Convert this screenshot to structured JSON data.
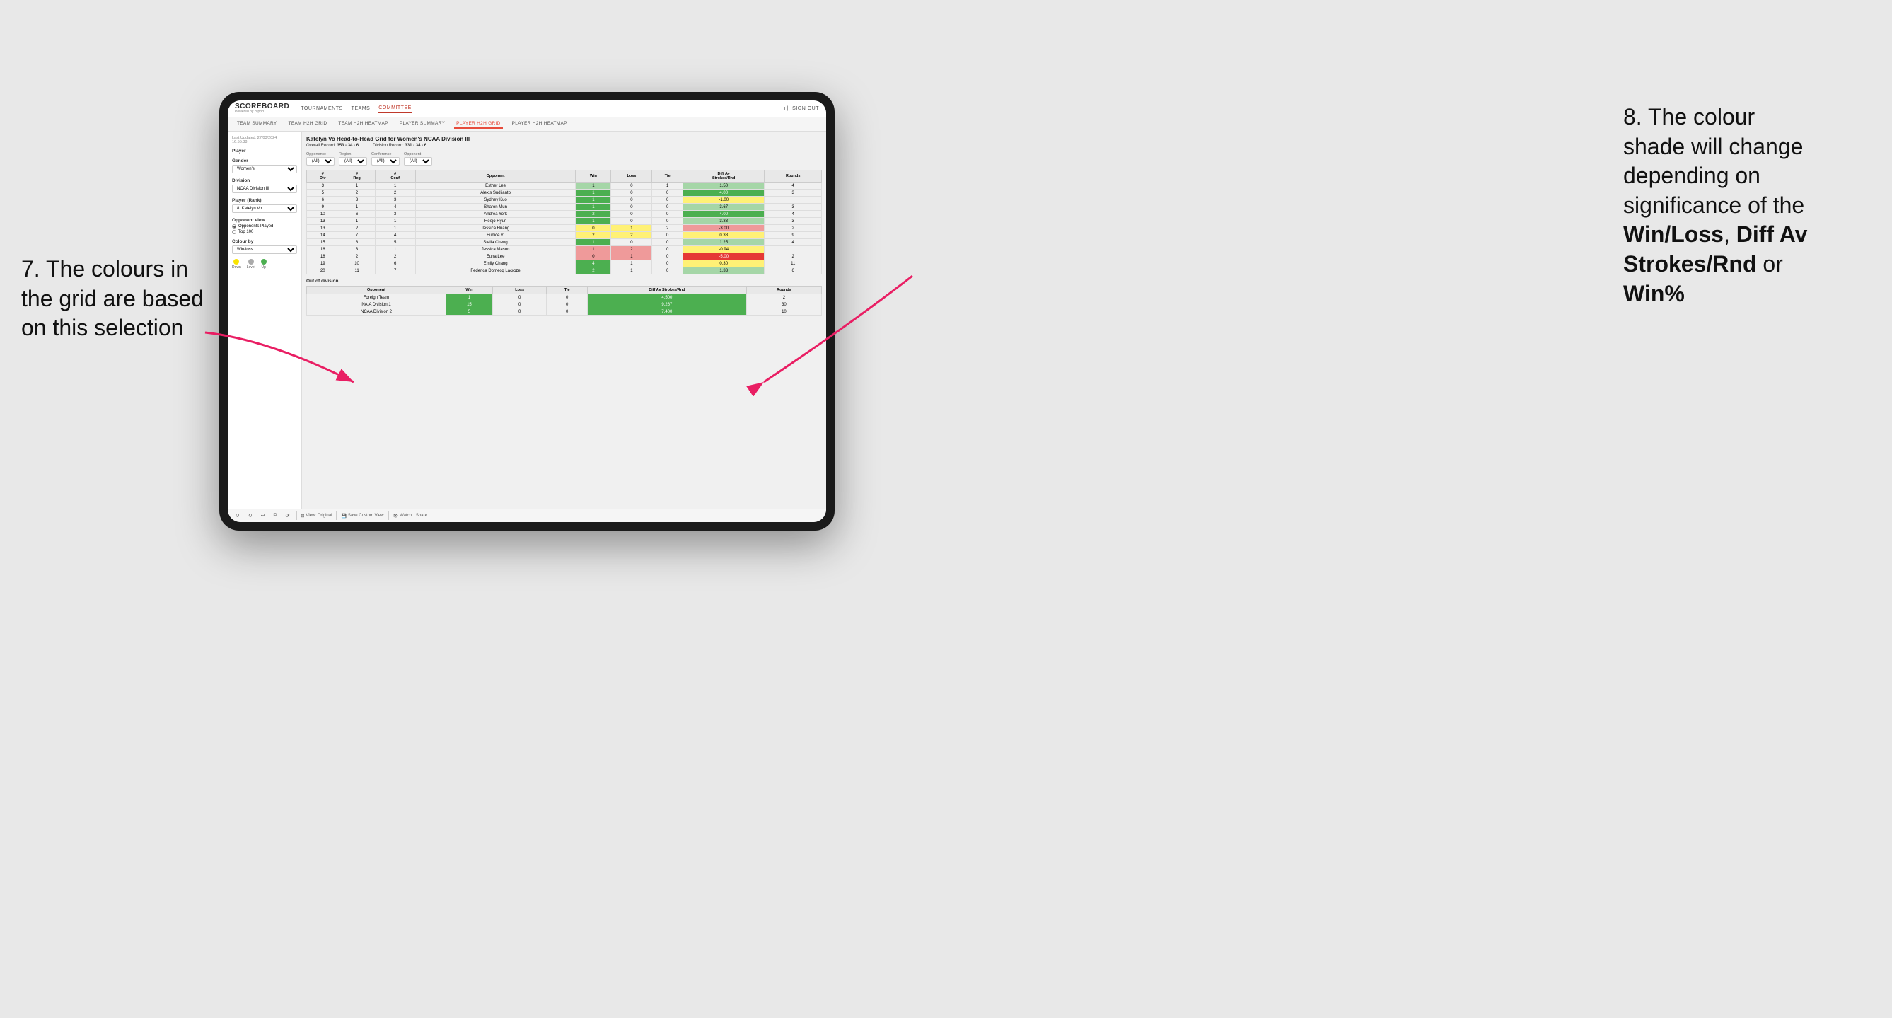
{
  "annotations": {
    "left": {
      "line1": "7. The colours in",
      "line2": "the grid are based",
      "line3": "on this selection"
    },
    "right": {
      "line1": "8. The colour",
      "line2": "shade will change",
      "line3": "depending on",
      "line4": "significance of the",
      "bold1": "Win/Loss",
      "sep1": ", ",
      "bold2": "Diff Av",
      "line5": "Strokes/Rnd",
      "sep2": " or",
      "bold3": "Win%"
    }
  },
  "nav": {
    "logo": "SCOREBOARD",
    "logo_sub": "Powered by clippd",
    "items": [
      "TOURNAMENTS",
      "TEAMS",
      "COMMITTEE"
    ],
    "active_item": "COMMITTEE",
    "sign_out": "Sign out"
  },
  "sub_nav": {
    "items": [
      "TEAM SUMMARY",
      "TEAM H2H GRID",
      "TEAM H2H HEATMAP",
      "PLAYER SUMMARY",
      "PLAYER H2H GRID",
      "PLAYER H2H HEATMAP"
    ],
    "active_item": "PLAYER H2H GRID"
  },
  "left_panel": {
    "last_updated_label": "Last Updated: 27/03/2024",
    "last_updated_time": "16:55:38",
    "player_section": "Player",
    "gender_label": "Gender",
    "gender_value": "Women's",
    "division_label": "Division",
    "division_value": "NCAA Division III",
    "player_rank_label": "Player (Rank)",
    "player_rank_value": "8. Katelyn Vo",
    "opponent_view_label": "Opponent view",
    "opponents_played": "Opponents Played",
    "top100": "Top 100",
    "colour_by_label": "Colour by",
    "colour_by_value": "Win/loss",
    "legend": {
      "down_color": "#f9e400",
      "level_color": "#aaaaaa",
      "up_color": "#4caf50",
      "down_label": "Down",
      "level_label": "Level",
      "up_label": "Up"
    }
  },
  "main_grid": {
    "title": "Katelyn Vo Head-to-Head Grid for Women's NCAA Division III",
    "overall_record_label": "Overall Record:",
    "overall_record": "353 - 34 - 6",
    "division_record_label": "Division Record:",
    "division_record": "331 - 34 - 6",
    "filters": {
      "opponents_label": "Opponents:",
      "opponents_value": "(All)",
      "region_label": "Region",
      "region_value": "(All)",
      "conference_label": "Conference",
      "conference_value": "(All)",
      "opponent_label": "Opponent",
      "opponent_value": "(All)"
    },
    "table_headers": [
      "#\nDiv",
      "#\nReg",
      "#\nConf",
      "Opponent",
      "Win",
      "Loss",
      "Tie",
      "Diff Av\nStrokes/Rnd",
      "Rounds"
    ],
    "rows": [
      {
        "div": "3",
        "reg": "1",
        "conf": "1",
        "opponent": "Esther Lee",
        "win": "1",
        "loss": "0",
        "tie": "1",
        "diff": "1.50",
        "rounds": "4",
        "win_class": "bg-green-light",
        "diff_class": "bg-green-light"
      },
      {
        "div": "5",
        "reg": "2",
        "conf": "2",
        "opponent": "Alexis Sudjianto",
        "win": "1",
        "loss": "0",
        "tie": "0",
        "diff": "4.00",
        "rounds": "3",
        "win_class": "bg-green-dark",
        "diff_class": "bg-green-dark"
      },
      {
        "div": "6",
        "reg": "3",
        "conf": "3",
        "opponent": "Sydney Kuo",
        "win": "1",
        "loss": "0",
        "tie": "0",
        "diff": "-1.00",
        "rounds": "",
        "win_class": "bg-green-dark",
        "diff_class": "bg-yellow"
      },
      {
        "div": "9",
        "reg": "1",
        "conf": "4",
        "opponent": "Sharon Mun",
        "win": "1",
        "loss": "0",
        "tie": "0",
        "diff": "3.67",
        "rounds": "3",
        "win_class": "bg-green-dark",
        "diff_class": "bg-green-light"
      },
      {
        "div": "10",
        "reg": "6",
        "conf": "3",
        "opponent": "Andrea York",
        "win": "2",
        "loss": "0",
        "tie": "0",
        "diff": "4.00",
        "rounds": "4",
        "win_class": "bg-green-dark",
        "diff_class": "bg-green-dark"
      },
      {
        "div": "13",
        "reg": "1",
        "conf": "1",
        "opponent": "Heejo Hyun",
        "win": "1",
        "loss": "0",
        "tie": "0",
        "diff": "3.33",
        "rounds": "3",
        "win_class": "bg-green-dark",
        "diff_class": "bg-green-light"
      },
      {
        "div": "13",
        "reg": "2",
        "conf": "1",
        "opponent": "Jessica Huang",
        "win": "0",
        "loss": "1",
        "tie": "2",
        "diff": "-3.00",
        "rounds": "2",
        "win_class": "bg-yellow",
        "diff_class": "bg-red-light"
      },
      {
        "div": "14",
        "reg": "7",
        "conf": "4",
        "opponent": "Eunice Yi",
        "win": "2",
        "loss": "2",
        "tie": "0",
        "diff": "0.38",
        "rounds": "9",
        "win_class": "bg-yellow",
        "diff_class": "bg-yellow"
      },
      {
        "div": "15",
        "reg": "8",
        "conf": "5",
        "opponent": "Stella Cheng",
        "win": "1",
        "loss": "0",
        "tie": "0",
        "diff": "1.25",
        "rounds": "4",
        "win_class": "bg-green-dark",
        "diff_class": "bg-green-light"
      },
      {
        "div": "16",
        "reg": "3",
        "conf": "1",
        "opponent": "Jessica Mason",
        "win": "1",
        "loss": "2",
        "tie": "0",
        "diff": "-0.94",
        "rounds": "",
        "win_class": "bg-red-light",
        "diff_class": "bg-yellow"
      },
      {
        "div": "18",
        "reg": "2",
        "conf": "2",
        "opponent": "Euna Lee",
        "win": "0",
        "loss": "1",
        "tie": "0",
        "diff": "-5.00",
        "rounds": "2",
        "win_class": "bg-red-light",
        "diff_class": "bg-red-dark"
      },
      {
        "div": "19",
        "reg": "10",
        "conf": "6",
        "opponent": "Emily Chang",
        "win": "4",
        "loss": "1",
        "tie": "0",
        "diff": "0.30",
        "rounds": "11",
        "win_class": "bg-green-dark",
        "diff_class": "bg-yellow"
      },
      {
        "div": "20",
        "reg": "11",
        "conf": "7",
        "opponent": "Federica Domecq Lacroze",
        "win": "2",
        "loss": "1",
        "tie": "0",
        "diff": "1.33",
        "rounds": "6",
        "win_class": "bg-green-dark",
        "diff_class": "bg-green-light"
      }
    ],
    "out_of_division_label": "Out of division",
    "out_of_division_rows": [
      {
        "opponent": "Foreign Team",
        "win": "1",
        "loss": "0",
        "tie": "0",
        "diff": "4.500",
        "rounds": "2",
        "win_class": "bg-green-dark",
        "diff_class": "bg-green-dark"
      },
      {
        "opponent": "NAIA Division 1",
        "win": "15",
        "loss": "0",
        "tie": "0",
        "diff": "9.267",
        "rounds": "30",
        "win_class": "bg-green-dark",
        "diff_class": "bg-green-dark"
      },
      {
        "opponent": "NCAA Division 2",
        "win": "5",
        "loss": "0",
        "tie": "0",
        "diff": "7.400",
        "rounds": "10",
        "win_class": "bg-green-dark",
        "diff_class": "bg-green-dark"
      }
    ]
  },
  "toolbar": {
    "view_original": "View: Original",
    "save_custom_view": "Save Custom View",
    "watch": "Watch",
    "share": "Share"
  }
}
